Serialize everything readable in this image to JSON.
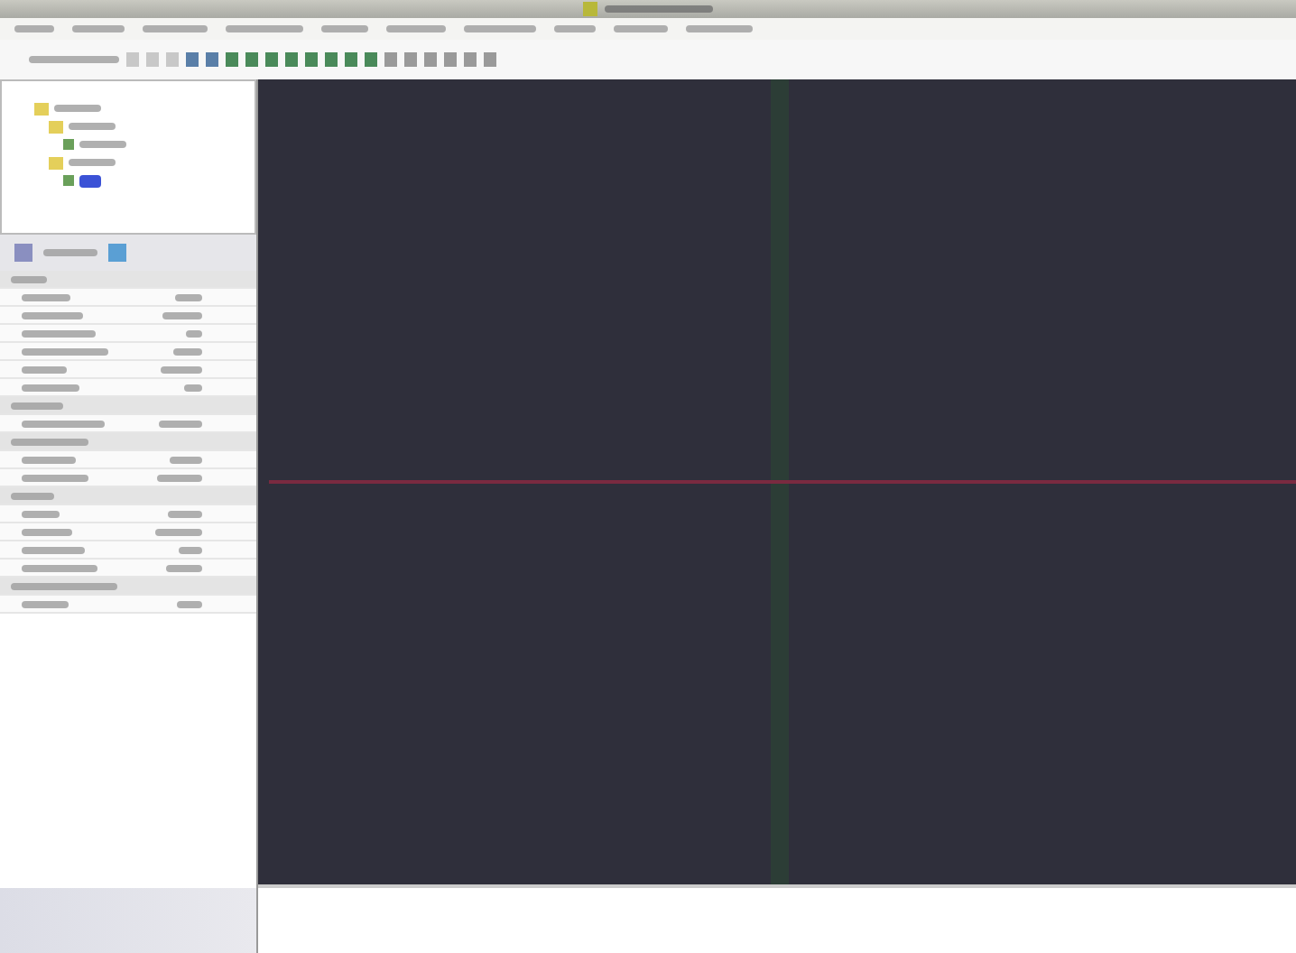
{
  "menu_bar": {
    "items": [
      {
        "kind": "menu"
      },
      {
        "kind": "menu"
      },
      {
        "kind": "menu"
      },
      {
        "kind": "menu"
      },
      {
        "kind": "menu"
      },
      {
        "kind": "menu"
      },
      {
        "kind": "menu"
      },
      {
        "kind": "menu"
      },
      {
        "kind": "menu"
      },
      {
        "kind": "menu"
      }
    ]
  },
  "toolbar": {
    "buttons": [
      {
        "kind": "plain"
      },
      {
        "kind": "plain"
      },
      {
        "kind": "plain"
      },
      {
        "kind": "blue"
      },
      {
        "kind": "blue"
      },
      {
        "kind": "green"
      },
      {
        "kind": "green"
      },
      {
        "kind": "green"
      },
      {
        "kind": "green"
      },
      {
        "kind": "green"
      },
      {
        "kind": "green"
      },
      {
        "kind": "green"
      },
      {
        "kind": "green"
      },
      {
        "kind": "gray"
      },
      {
        "kind": "gray"
      },
      {
        "kind": "gray"
      },
      {
        "kind": "gray"
      },
      {
        "kind": "gray"
      },
      {
        "kind": "gray"
      }
    ]
  },
  "scene_tree": {
    "items": [
      {
        "kind": "folder",
        "expanded": true,
        "children": [
          {
            "kind": "folder",
            "expanded": true,
            "children": [
              {
                "kind": "node",
                "selected": false
              }
            ]
          },
          {
            "kind": "folder",
            "expanded": true,
            "children": [
              {
                "kind": "node",
                "selected": true
              }
            ]
          }
        ]
      }
    ]
  },
  "properties": {
    "rows": [
      {
        "kind": "section"
      },
      {
        "kind": "pair"
      },
      {
        "kind": "pair"
      },
      {
        "kind": "pair"
      },
      {
        "kind": "pair"
      },
      {
        "kind": "pair"
      },
      {
        "kind": "pair"
      },
      {
        "kind": "section"
      },
      {
        "kind": "pair"
      },
      {
        "kind": "section"
      },
      {
        "kind": "pair"
      },
      {
        "kind": "pair"
      },
      {
        "kind": "section"
      },
      {
        "kind": "pair"
      },
      {
        "kind": "pair"
      },
      {
        "kind": "pair"
      },
      {
        "kind": "pair"
      },
      {
        "kind": "section"
      },
      {
        "kind": "pair"
      }
    ]
  },
  "viewport": {
    "kind": "axes"
  }
}
